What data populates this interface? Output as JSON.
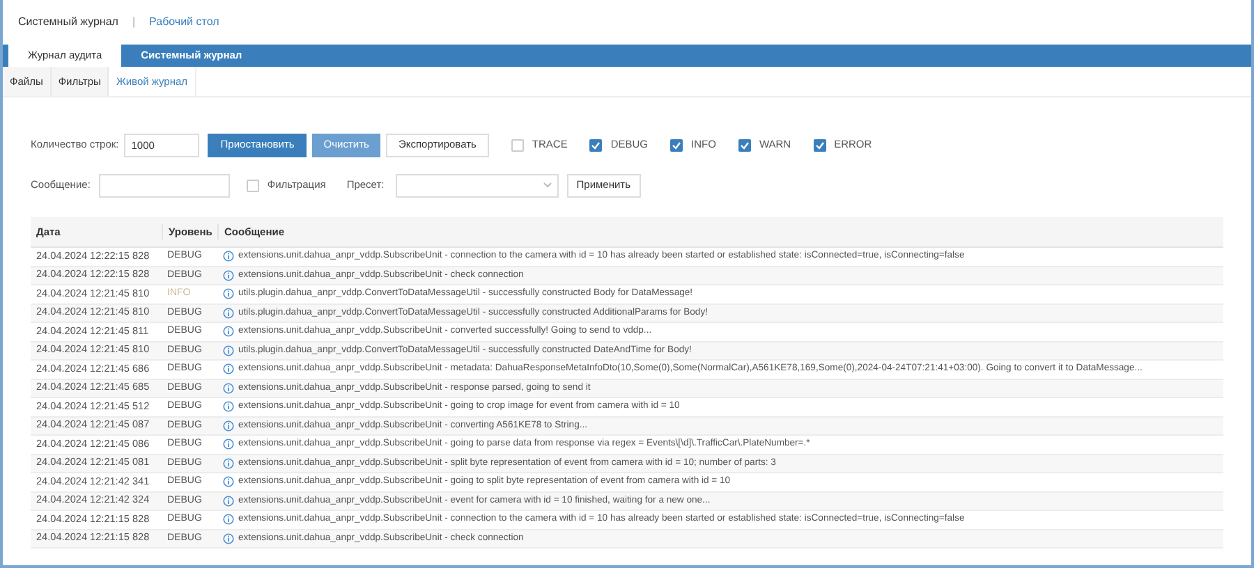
{
  "header": {
    "title": "Системный журнал",
    "separator": "|",
    "link": "Рабочий стол"
  },
  "tabs": [
    {
      "label": "Журнал аудита",
      "selected": true
    },
    {
      "label": "Системный журнал",
      "selected": false
    }
  ],
  "subtabs": [
    {
      "label": "Файлы",
      "selected": false
    },
    {
      "label": "Фильтры",
      "selected": false
    },
    {
      "label": "Живой журнал",
      "selected": true
    }
  ],
  "controls": {
    "rows_label": "Количество строк:",
    "rows_value": "1000",
    "pause_button": "Приостановить",
    "clear_button": "Очистить",
    "export_button": "Экспортировать",
    "levels": [
      {
        "label": "TRACE",
        "checked": false
      },
      {
        "label": "DEBUG",
        "checked": true
      },
      {
        "label": "INFO",
        "checked": true
      },
      {
        "label": "WARN",
        "checked": true
      },
      {
        "label": "ERROR",
        "checked": true
      }
    ],
    "message_label": "Сообщение:",
    "filter": {
      "label": "Фильтрация",
      "checked": false
    },
    "preset_label": "Пресет:",
    "apply_button": "Применить"
  },
  "table": {
    "columns": [
      "Дата",
      "Уровень",
      "Сообщение"
    ],
    "rows": [
      {
        "date": "24.04.2024 12:22:15 828",
        "level": "DEBUG",
        "kind": "debug",
        "message": "extensions.unit.dahua_anpr_vddp.SubscribeUnit - connection to the camera with id = 10 has already been started or established state: isConnected=true, isConnecting=false"
      },
      {
        "date": "24.04.2024 12:22:15 828",
        "level": "DEBUG",
        "kind": "debug",
        "message": "extensions.unit.dahua_anpr_vddp.SubscribeUnit - check connection"
      },
      {
        "date": "24.04.2024 12:21:45 810",
        "level": "INFO",
        "kind": "info",
        "message": "utils.plugin.dahua_anpr_vddp.ConvertToDataMessageUtil - successfully constructed Body for DataMessage!"
      },
      {
        "date": "24.04.2024 12:21:45 810",
        "level": "DEBUG",
        "kind": "debug",
        "message": "utils.plugin.dahua_anpr_vddp.ConvertToDataMessageUtil - successfully constructed AdditionalParams for Body!"
      },
      {
        "date": "24.04.2024 12:21:45 811",
        "level": "DEBUG",
        "kind": "debug",
        "message": "extensions.unit.dahua_anpr_vddp.SubscribeUnit - converted successfully! Going to send to vddp..."
      },
      {
        "date": "24.04.2024 12:21:45 810",
        "level": "DEBUG",
        "kind": "debug",
        "message": "utils.plugin.dahua_anpr_vddp.ConvertToDataMessageUtil - successfully constructed DateAndTime for Body!"
      },
      {
        "date": "24.04.2024 12:21:45 686",
        "level": "DEBUG",
        "kind": "debug",
        "message": "extensions.unit.dahua_anpr_vddp.SubscribeUnit - metadata: DahuaResponseMetaInfoDto(10,Some(0),Some(NormalCar),A561KE78,169,Some(0),2024-04-24T07:21:41+03:00). Going to convert it to DataMessage..."
      },
      {
        "date": "24.04.2024 12:21:45 685",
        "level": "DEBUG",
        "kind": "debug",
        "message": "extensions.unit.dahua_anpr_vddp.SubscribeUnit - response parsed, going to send it"
      },
      {
        "date": "24.04.2024 12:21:45 512",
        "level": "DEBUG",
        "kind": "debug",
        "message": "extensions.unit.dahua_anpr_vddp.SubscribeUnit - going to crop image for event from camera with id = 10"
      },
      {
        "date": "24.04.2024 12:21:45 087",
        "level": "DEBUG",
        "kind": "debug",
        "message": "extensions.unit.dahua_anpr_vddp.SubscribeUnit - converting A561KE78 to String..."
      },
      {
        "date": "24.04.2024 12:21:45 086",
        "level": "DEBUG",
        "kind": "debug",
        "message": "extensions.unit.dahua_anpr_vddp.SubscribeUnit - going to parse data from response via regex = Events\\[\\d]\\.TrafficCar\\.PlateNumber=.*"
      },
      {
        "date": "24.04.2024 12:21:45 081",
        "level": "DEBUG",
        "kind": "debug",
        "message": "extensions.unit.dahua_anpr_vddp.SubscribeUnit - split byte representation of event from camera with id = 10; number of parts: 3"
      },
      {
        "date": "24.04.2024 12:21:42 341",
        "level": "DEBUG",
        "kind": "debug",
        "message": "extensions.unit.dahua_anpr_vddp.SubscribeUnit - going to split byte representation of event from camera with id = 10"
      },
      {
        "date": "24.04.2024 12:21:42 324",
        "level": "DEBUG",
        "kind": "debug",
        "message": "extensions.unit.dahua_anpr_vddp.SubscribeUnit - event for camera with id = 10 finished, waiting for a new one..."
      },
      {
        "date": "24.04.2024 12:21:15 828",
        "level": "DEBUG",
        "kind": "debug",
        "message": "extensions.unit.dahua_anpr_vddp.SubscribeUnit - connection to the camera with id = 10 has already been started or established state: isConnected=true, isConnecting=false"
      },
      {
        "date": "24.04.2024 12:21:15 828",
        "level": "DEBUG",
        "kind": "debug",
        "message": "extensions.unit.dahua_anpr_vddp.SubscribeUnit - check connection"
      }
    ]
  }
}
